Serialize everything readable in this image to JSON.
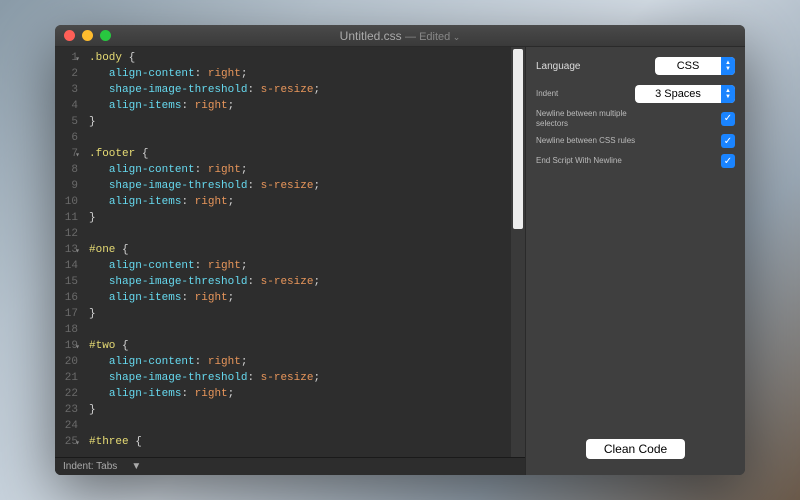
{
  "window": {
    "title": "Untitled.css",
    "edited_suffix": "— Edited"
  },
  "code": {
    "lines": [
      {
        "n": 1,
        "fold": true,
        "tokens": [
          [
            "selector",
            ".body"
          ],
          [
            "punct",
            " "
          ],
          [
            "brace",
            "{"
          ]
        ]
      },
      {
        "n": 2,
        "tokens": [
          [
            "pad",
            "   "
          ],
          [
            "prop",
            "align-content"
          ],
          [
            "punct",
            ": "
          ],
          [
            "value",
            "right"
          ],
          [
            "punct",
            ";"
          ]
        ]
      },
      {
        "n": 3,
        "tokens": [
          [
            "pad",
            "   "
          ],
          [
            "prop",
            "shape-image-threshold"
          ],
          [
            "punct",
            ": "
          ],
          [
            "value",
            "s-resize"
          ],
          [
            "punct",
            ";"
          ]
        ]
      },
      {
        "n": 4,
        "tokens": [
          [
            "pad",
            "   "
          ],
          [
            "prop",
            "align-items"
          ],
          [
            "punct",
            ": "
          ],
          [
            "value",
            "right"
          ],
          [
            "punct",
            ";"
          ]
        ]
      },
      {
        "n": 5,
        "tokens": [
          [
            "brace",
            "}"
          ]
        ]
      },
      {
        "n": 6,
        "tokens": []
      },
      {
        "n": 7,
        "fold": true,
        "tokens": [
          [
            "selector",
            ".footer"
          ],
          [
            "punct",
            " "
          ],
          [
            "brace",
            "{"
          ]
        ]
      },
      {
        "n": 8,
        "tokens": [
          [
            "pad",
            "   "
          ],
          [
            "prop",
            "align-content"
          ],
          [
            "punct",
            ": "
          ],
          [
            "value",
            "right"
          ],
          [
            "punct",
            ";"
          ]
        ]
      },
      {
        "n": 9,
        "tokens": [
          [
            "pad",
            "   "
          ],
          [
            "prop",
            "shape-image-threshold"
          ],
          [
            "punct",
            ": "
          ],
          [
            "value",
            "s-resize"
          ],
          [
            "punct",
            ";"
          ]
        ]
      },
      {
        "n": 10,
        "tokens": [
          [
            "pad",
            "   "
          ],
          [
            "prop",
            "align-items"
          ],
          [
            "punct",
            ": "
          ],
          [
            "value",
            "right"
          ],
          [
            "punct",
            ";"
          ]
        ]
      },
      {
        "n": 11,
        "tokens": [
          [
            "brace",
            "}"
          ]
        ]
      },
      {
        "n": 12,
        "tokens": []
      },
      {
        "n": 13,
        "fold": true,
        "tokens": [
          [
            "selector",
            "#one"
          ],
          [
            "punct",
            " "
          ],
          [
            "brace",
            "{"
          ]
        ]
      },
      {
        "n": 14,
        "tokens": [
          [
            "pad",
            "   "
          ],
          [
            "prop",
            "align-content"
          ],
          [
            "punct",
            ": "
          ],
          [
            "value",
            "right"
          ],
          [
            "punct",
            ";"
          ]
        ]
      },
      {
        "n": 15,
        "tokens": [
          [
            "pad",
            "   "
          ],
          [
            "prop",
            "shape-image-threshold"
          ],
          [
            "punct",
            ": "
          ],
          [
            "value",
            "s-resize"
          ],
          [
            "punct",
            ";"
          ]
        ]
      },
      {
        "n": 16,
        "tokens": [
          [
            "pad",
            "   "
          ],
          [
            "prop",
            "align-items"
          ],
          [
            "punct",
            ": "
          ],
          [
            "value",
            "right"
          ],
          [
            "punct",
            ";"
          ]
        ]
      },
      {
        "n": 17,
        "tokens": [
          [
            "brace",
            "}"
          ]
        ]
      },
      {
        "n": 18,
        "tokens": []
      },
      {
        "n": 19,
        "fold": true,
        "tokens": [
          [
            "selector",
            "#two"
          ],
          [
            "punct",
            " "
          ],
          [
            "brace",
            "{"
          ]
        ]
      },
      {
        "n": 20,
        "tokens": [
          [
            "pad",
            "   "
          ],
          [
            "prop",
            "align-content"
          ],
          [
            "punct",
            ": "
          ],
          [
            "value",
            "right"
          ],
          [
            "punct",
            ";"
          ]
        ]
      },
      {
        "n": 21,
        "tokens": [
          [
            "pad",
            "   "
          ],
          [
            "prop",
            "shape-image-threshold"
          ],
          [
            "punct",
            ": "
          ],
          [
            "value",
            "s-resize"
          ],
          [
            "punct",
            ";"
          ]
        ]
      },
      {
        "n": 22,
        "tokens": [
          [
            "pad",
            "   "
          ],
          [
            "prop",
            "align-items"
          ],
          [
            "punct",
            ": "
          ],
          [
            "value",
            "right"
          ],
          [
            "punct",
            ";"
          ]
        ]
      },
      {
        "n": 23,
        "tokens": [
          [
            "brace",
            "}"
          ]
        ]
      },
      {
        "n": 24,
        "tokens": []
      },
      {
        "n": 25,
        "fold": true,
        "tokens": [
          [
            "selector",
            "#three"
          ],
          [
            "punct",
            " "
          ],
          [
            "brace",
            "{"
          ]
        ]
      }
    ]
  },
  "status": {
    "indent_label": "Indent: Tabs",
    "dropdown_glyph": "▼"
  },
  "sidebar": {
    "language_label": "Language",
    "language_value": "CSS",
    "indent_label": "Indent",
    "indent_value": "3 Spaces",
    "opts": [
      {
        "label": "Newline between multiple selectors",
        "checked": true
      },
      {
        "label": "Newline between CSS rules",
        "checked": true
      },
      {
        "label": "End Script With Newline",
        "checked": true
      }
    ],
    "clean_button": "Clean Code"
  }
}
